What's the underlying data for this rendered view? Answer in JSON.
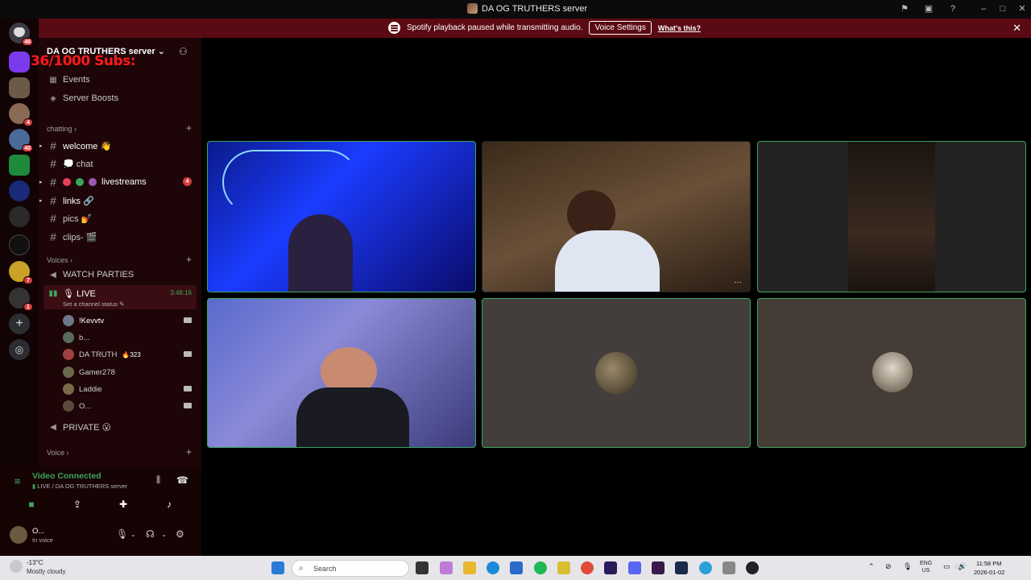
{
  "window": {
    "title": "DA OG TRUTHERS server"
  },
  "banner": {
    "message": "Spotify playback paused while transmitting audio.",
    "voice_settings_label": "Voice Settings",
    "whats_this_label": "What's this?"
  },
  "overlay": {
    "subs_text": "36/1000  Subs:"
  },
  "rail_badges": {
    "home": "46",
    "srv3": "4",
    "srv4": "40",
    "srv10": "7",
    "srv11": "1"
  },
  "sidebar": {
    "server_name": "DA OG TRUTHERS server",
    "top_items": [
      {
        "label": "Events"
      },
      {
        "label": "Server Boosts"
      }
    ],
    "categories": {
      "chatting": "chatting",
      "voices": "Voices",
      "voice": "Voice"
    },
    "text_channels": [
      {
        "label": "welcome 👋"
      },
      {
        "label": "💭 chat"
      },
      {
        "label": "livestreams",
        "mention": "4"
      },
      {
        "label": "links 🔗"
      },
      {
        "label": "pics 💅"
      },
      {
        "label": "clips- 🎬"
      }
    ],
    "voice_channels": {
      "watch_parties": "WATCH PARTIES",
      "live": "🎙 LIVE",
      "live_timer": "3:48:16",
      "live_status": "Set a channel status",
      "private": "PRIVATE 😮"
    },
    "members": [
      {
        "name": "!Kevvtv"
      },
      {
        "name": "b..."
      },
      {
        "name": "DA TRUTH",
        "extra": "323"
      },
      {
        "name": "Gamer278"
      },
      {
        "name": "Laddie"
      },
      {
        "name": "O..."
      }
    ]
  },
  "voice_panel": {
    "status": "Video Connected",
    "location": "LIVE / DA OG TRUTHERS server",
    "user_name": "O...",
    "user_status": "In voice"
  },
  "taskbar": {
    "weather_temp": "-13°C",
    "weather_desc": "Mostly cloudy",
    "search_placeholder": "Search",
    "lang_line1": "ENG",
    "lang_line2": "US",
    "time": "11:58 PM",
    "date": "2026-01-02"
  },
  "colors": {
    "accent_green": "#3ba55d",
    "banner_bg": "#5a0a12",
    "sidebar_bg": "#1e0508",
    "mention_red": "#d83c3e"
  }
}
